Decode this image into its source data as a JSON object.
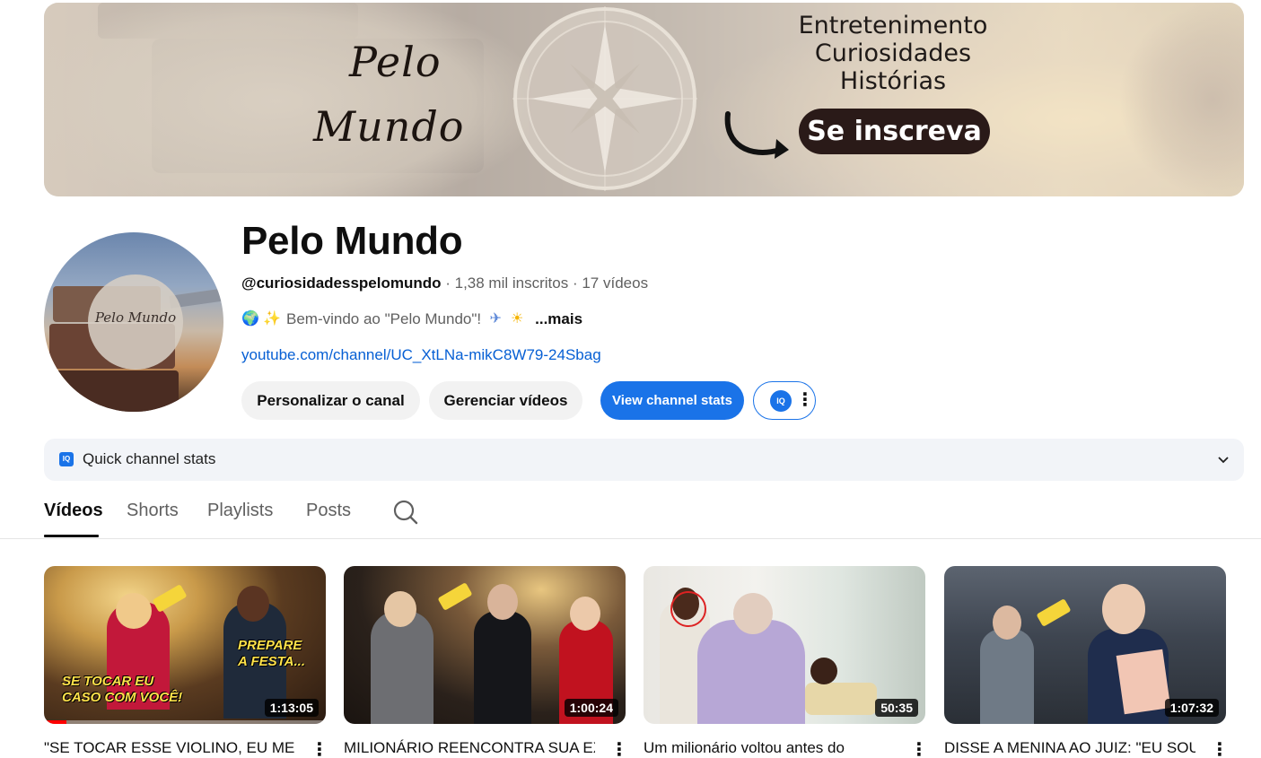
{
  "banner": {
    "logo_line1": "Pelo",
    "logo_line2": "Mundo",
    "tagline": [
      "Entretenimento",
      "Curiosidades",
      "Histórias"
    ],
    "subscribe_label": "Se inscreva"
  },
  "avatar": {
    "text": "Pelo Mundo"
  },
  "channel": {
    "name": "Pelo Mundo",
    "handle": "@curiosidadesspelomundo",
    "subscribers": "1,38 mil inscritos",
    "videos_count": "17 vídeos",
    "separator": " · ",
    "description": "Bem-vindo ao \"Pelo Mundo\"!",
    "more_label": "...mais",
    "link": "youtube.com/channel/UC_XtLNa-mikC8W79-24Sbag"
  },
  "buttons": {
    "customize": "Personalizar o canal",
    "manage": "Gerenciar vídeos",
    "stats": "View channel stats",
    "iq": "IQ"
  },
  "quick_stats": {
    "label": "Quick channel stats",
    "badge": "IQ"
  },
  "tabs": [
    {
      "label": "Vídeos",
      "active": true
    },
    {
      "label": "Shorts",
      "active": false
    },
    {
      "label": "Playlists",
      "active": false
    },
    {
      "label": "Posts",
      "active": false
    }
  ],
  "videos": [
    {
      "title": "\"SE TOCAR ESSE VIOLINO, EU ME",
      "duration": "1:13:05",
      "caption_left": "SE TOCAR EU CASO COM VOCÊ!",
      "caption_right": "PREPARE A FESTA...",
      "watched": 0.08
    },
    {
      "title": "MILIONÁRIO REENCONTRA SUA EX",
      "duration": "1:00:24"
    },
    {
      "title": "Um milionário voltou antes do",
      "duration": "50:35"
    },
    {
      "title": "DISSE A MENINA AO JUIZ: \"EU SOU",
      "duration": "1:07:32"
    }
  ],
  "colors": {
    "accent_blue": "#1a73e8",
    "link_blue": "#065fd4",
    "subscribe_bg": "#2a1a18"
  },
  "icons": {
    "search": "search-icon",
    "chevron": "chevron-down-icon",
    "kebab": "more-vert-icon"
  }
}
